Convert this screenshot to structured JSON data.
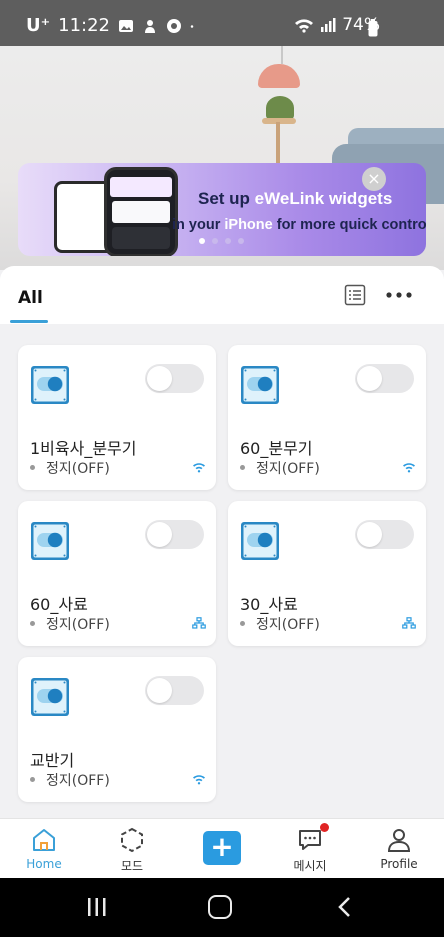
{
  "status_bar": {
    "carrier": "U⁺",
    "time": "11:22",
    "battery": "74%"
  },
  "banner": {
    "line1_a": "Set up ",
    "line1_b": "eWeLink widgets",
    "line2_a": "in your ",
    "line2_b": "iPhone",
    "line2_c": " for more quick contro",
    "close": "×"
  },
  "tabs": {
    "all": "All"
  },
  "devices": [
    {
      "name": "1비육사_분무기",
      "status": "정지(OFF)",
      "connection": "wifi-icon"
    },
    {
      "name": "60_분무기",
      "status": "정지(OFF)",
      "connection": "wifi-icon"
    },
    {
      "name": "60_사료",
      "status": "정지(OFF)",
      "connection": "network-icon"
    },
    {
      "name": "30_사료",
      "status": "정지(OFF)",
      "connection": "network-icon"
    },
    {
      "name": "교반기",
      "status": "정지(OFF)",
      "connection": "wifi-icon"
    }
  ],
  "nav": {
    "home": "Home",
    "mode": "모드",
    "add": "+",
    "messages": "메시지",
    "profile": "Profile"
  },
  "colors": {
    "accent": "#3aa0d8",
    "add_button": "#2a9be0",
    "badge": "#e02424",
    "toggle_off": "#e7e7e9"
  }
}
